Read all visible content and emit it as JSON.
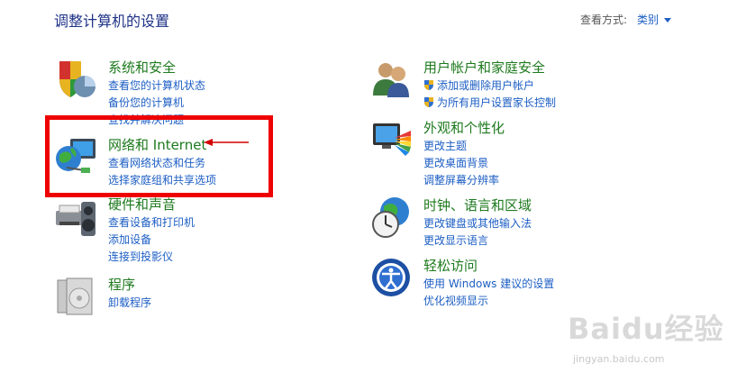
{
  "header": {
    "title": "调整计算机的设置",
    "view_by_label": "查看方式:",
    "view_by_value": "类别"
  },
  "categories": [
    {
      "title": "系统和安全",
      "icon": "system-security-icon",
      "links": [
        "查看您的计算机状态",
        "备份您的计算机",
        "查找并解决问题"
      ]
    },
    {
      "title": "网络和 Internet",
      "icon": "network-internet-icon",
      "links": [
        "查看网络状态和任务",
        "选择家庭组和共享选项"
      ]
    },
    {
      "title": "硬件和声音",
      "icon": "hardware-sound-icon",
      "links": [
        "查看设备和打印机",
        "添加设备",
        "连接到投影仪"
      ]
    },
    {
      "title": "程序",
      "icon": "programs-icon",
      "links": [
        "卸载程序"
      ]
    },
    {
      "title": "用户帐户和家庭安全",
      "icon": "user-accounts-icon",
      "links": [
        "添加或删除用户帐户",
        "为所有用户设置家长控制"
      ]
    },
    {
      "title": "外观和个性化",
      "icon": "appearance-icon",
      "links": [
        "更改主题",
        "更改桌面背景",
        "调整屏幕分辨率"
      ]
    },
    {
      "title": "时钟、语言和区域",
      "icon": "clock-language-icon",
      "links": [
        "更改键盘或其他输入法",
        "更改显示语言"
      ]
    },
    {
      "title": "轻松访问",
      "icon": "ease-of-access-icon",
      "links": [
        "使用 Windows 建议的设置",
        "优化视频显示"
      ]
    }
  ],
  "watermark": {
    "main": "Baidu经验",
    "sub": "jingyan.baidu.com"
  },
  "colors": {
    "title_blue": "#1e3287",
    "category_green": "#1e7a1e",
    "link_blue": "#1c5ec4",
    "highlight_red": "#ee0000"
  }
}
